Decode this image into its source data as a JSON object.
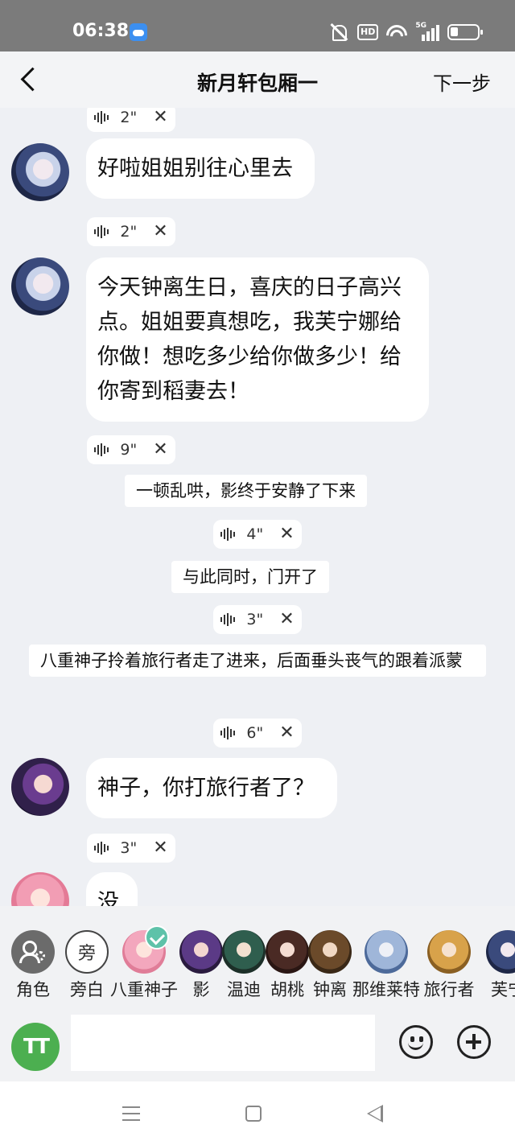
{
  "status": {
    "time": "06:38",
    "hd": "HD",
    "network": "5G"
  },
  "header": {
    "title": "新月轩包厢一",
    "next": "下一步"
  },
  "chat": [
    {
      "kind": "voice",
      "duration": "2\""
    },
    {
      "kind": "message",
      "speaker": "芙宁娜",
      "text": "好啦姐姐别往心里去"
    },
    {
      "kind": "voice",
      "duration": "2\""
    },
    {
      "kind": "message",
      "speaker": "芙宁娜",
      "text": "今天钟离生日，喜庆的日子高兴点。姐姐要真想吃，我芙宁娜给你做！想吃多少给你做多少！给你寄到稻妻去！"
    },
    {
      "kind": "voice",
      "duration": "9\""
    },
    {
      "kind": "narration",
      "text": "一顿乱哄，影终于安静了下来"
    },
    {
      "kind": "voice",
      "duration": "4\""
    },
    {
      "kind": "narration",
      "text": "与此同时，门开了"
    },
    {
      "kind": "voice",
      "duration": "3\""
    },
    {
      "kind": "narration",
      "text": "八重神子拎着旅行者走了进来，后面垂头丧气的跟着派蒙"
    },
    {
      "kind": "voice",
      "duration": "6\""
    },
    {
      "kind": "message",
      "speaker": "影",
      "text": "神子，你打旅行者了？"
    },
    {
      "kind": "voice",
      "duration": "3\""
    },
    {
      "kind": "message",
      "speaker": "八重神子",
      "text": "没"
    }
  ],
  "close_glyph": "✕",
  "characters": [
    {
      "name": "角色",
      "icon": "role-settings-icon"
    },
    {
      "name": "旁白",
      "icon": "narrator-icon",
      "glyph": "旁"
    },
    {
      "name": "八重神子",
      "selected": true,
      "color": "#f3a7bd"
    },
    {
      "name": "影",
      "color": "#5b3a86"
    },
    {
      "name": "温迪",
      "color": "#2f5e4e"
    },
    {
      "name": "胡桃",
      "color": "#4a2a24"
    },
    {
      "name": "钟离",
      "color": "#6b4a2a"
    },
    {
      "name": "那维莱特",
      "color": "#9fb6d9"
    },
    {
      "name": "旅行者",
      "color": "#d8a24a"
    },
    {
      "name": "芙宁",
      "color": "#3a4a7c"
    }
  ],
  "input": {
    "font_button": "TT",
    "placeholder": ""
  },
  "colors": {
    "accent_green": "#4caf50",
    "check": "#5ec2a9"
  }
}
